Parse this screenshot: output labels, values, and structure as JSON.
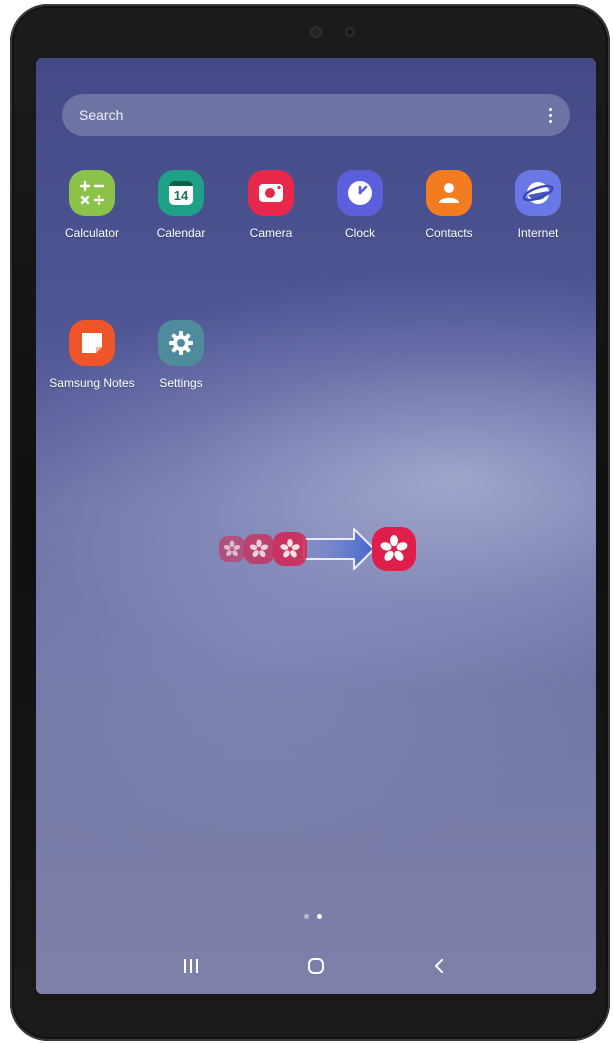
{
  "search": {
    "placeholder": "Search"
  },
  "apps": [
    {
      "label": "Calculator",
      "icon": "calculator-icon",
      "color": "#8bc34a"
    },
    {
      "label": "Calendar",
      "icon": "calendar-icon",
      "color": "#1fa187",
      "date": "14"
    },
    {
      "label": "Camera",
      "icon": "camera-icon",
      "color": "#e8284a"
    },
    {
      "label": "Clock",
      "icon": "clock-icon",
      "color": "#5c5fdb"
    },
    {
      "label": "Contacts",
      "icon": "contacts-icon",
      "color": "#f47c20"
    },
    {
      "label": "Internet",
      "icon": "internet-icon",
      "color": "#6a78e6"
    },
    {
      "label": "Samsung Notes",
      "icon": "notes-icon",
      "color": "#f0552a"
    },
    {
      "label": "Settings",
      "icon": "settings-icon",
      "color": "#4f8b9c"
    }
  ],
  "gesture": {
    "icon": "gallery-icon",
    "description_icon": "arrow-right-icon",
    "color": "#e01e4c"
  },
  "page_indicator": {
    "total": 2,
    "current": 2
  },
  "navbar": {
    "recents_icon": "recents-icon",
    "home_icon": "home-icon",
    "back_icon": "back-icon"
  }
}
